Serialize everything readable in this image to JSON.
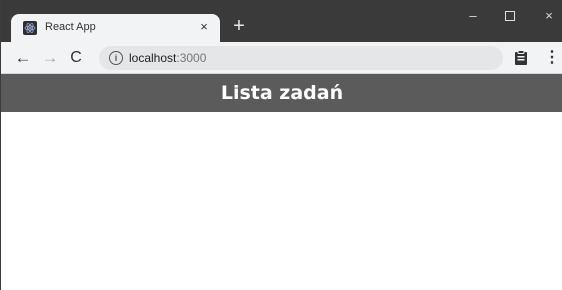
{
  "browser": {
    "tab": {
      "title": "React App",
      "close": "×"
    },
    "new_tab": "+",
    "window_controls": {
      "minimize": "–",
      "close": "×"
    },
    "nav": {
      "back": "←",
      "forward": "→",
      "reload": "C"
    },
    "address": {
      "host": "localhost",
      "port": ":3000"
    },
    "icons": [
      "react-favicon-icon",
      "info-icon",
      "clipboard-extension-icon",
      "kebab-menu-icon"
    ]
  },
  "page": {
    "header_title": "Lista zadań",
    "header_color": "#5b5b5b"
  }
}
